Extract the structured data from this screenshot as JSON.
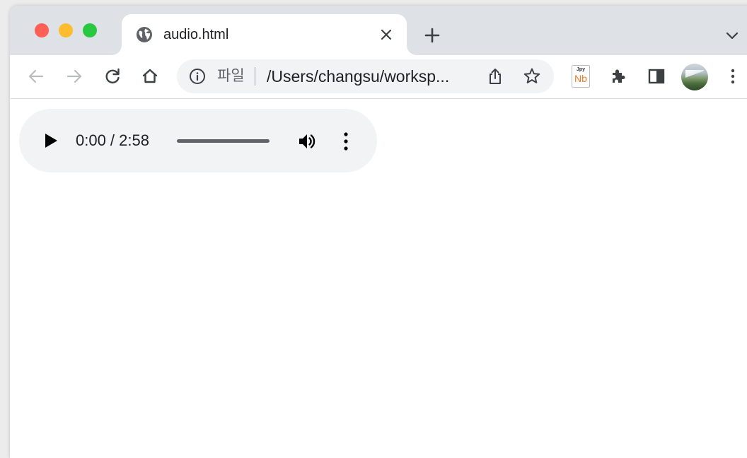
{
  "tab": {
    "title": "audio.html",
    "favicon": "globe-icon"
  },
  "toolbar": {
    "back": "arrow-back-icon",
    "forward": "arrow-forward-icon",
    "reload": "reload-icon",
    "home": "home-icon",
    "omnibox": {
      "scheme_label": "파일",
      "url": "/Users/changsu/worksp..."
    },
    "extensions": [
      "jupyter-notebook-icon",
      "puzzle-icon",
      "side-panel-icon"
    ],
    "jupyter": {
      "top": "Jpy",
      "bottom": "Nb"
    }
  },
  "audio_player": {
    "time": "0:00 / 2:58",
    "progress": 1.0
  },
  "colors": {
    "tabstrip": "#dee1e6",
    "omnibox": "#f1f3f4",
    "audio_bg": "#f1f3f4",
    "jupyter_orange": "#f37726"
  }
}
